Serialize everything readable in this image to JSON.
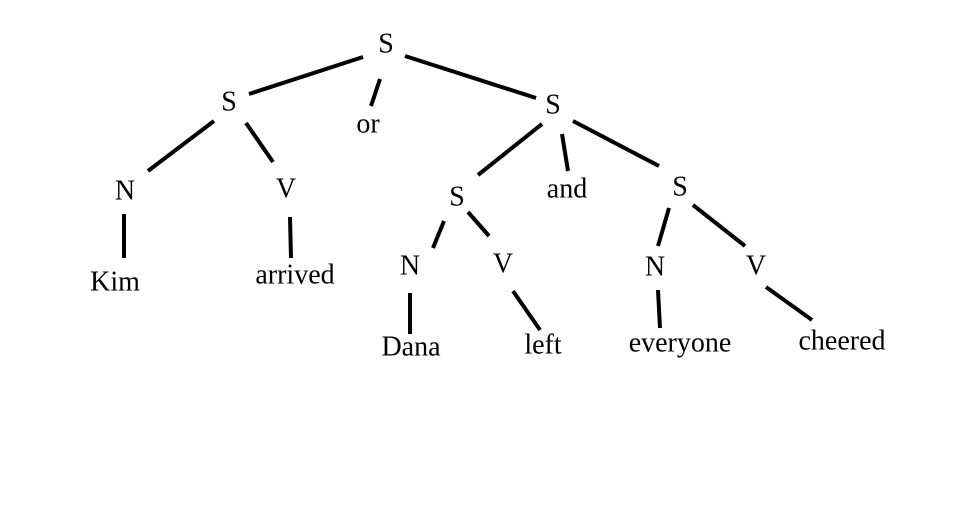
{
  "tree": {
    "nodes": {
      "s_root": "S",
      "s_left": "S",
      "or": "or",
      "s_right": "S",
      "n_kim": "N",
      "v_arrived": "V",
      "s_dana": "S",
      "and": "and",
      "s_everyone": "S",
      "kim": "Kim",
      "arrived": "arrived",
      "n_dana": "N",
      "v_left": "V",
      "n_everyone": "N",
      "v_cheered": "V",
      "dana": "Dana",
      "left": "left",
      "everyone": "everyone",
      "cheered": "cheered"
    }
  }
}
